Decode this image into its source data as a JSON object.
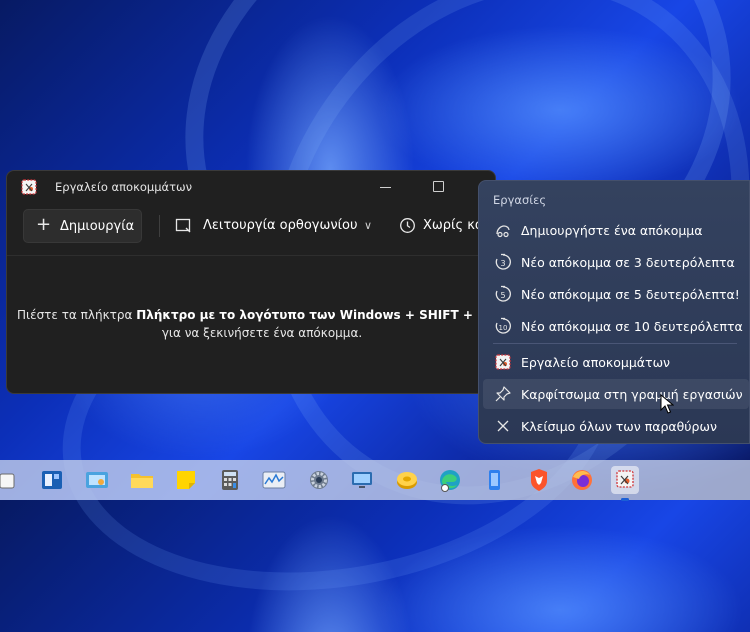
{
  "window": {
    "title": "Εργαλείο αποκομμάτων",
    "new_button": "Δημιουργία",
    "mode_label": "Λειτουργία ορθογωνίου",
    "delay_label": "Χωρίς κα",
    "message": {
      "pre": "Πιέστε τα πλήκτρα ",
      "bold": "Πλήκτρο με το λογότυπο των Windows + SHIFT +",
      "post_trunc": " ",
      "line2": "για να ξεκινήσετε ένα απόκομμα."
    }
  },
  "jumplist": {
    "header": "Εργασίες",
    "tasks": [
      {
        "label": "Δημιουργήστε ένα απόκομμα",
        "icon": "snip-icon"
      },
      {
        "label": "Νέο απόκομμα σε 3 δευτερόλεπτα",
        "icon": "timer-3-icon"
      },
      {
        "label": "Νέο απόκομμα σε 5 δευτερόλεπτα!",
        "icon": "timer-5-icon"
      },
      {
        "label": "Νέο απόκομμα σε 10 δευτερόλεπτα",
        "icon": "timer-10-icon"
      }
    ],
    "app": {
      "label": "Εργαλείο αποκομμάτων",
      "icon": "snipping-tool-icon"
    },
    "pin": {
      "label": "Καρφίτσωμα στη γραμμή εργασιών",
      "icon": "pin-icon"
    },
    "close_all": {
      "label": "Κλείσιμο όλων των παραθύρων",
      "icon": "close-icon"
    }
  },
  "taskbar": {
    "icons": [
      "task-view-icon",
      "widgets-icon",
      "control-panel-icon",
      "file-explorer-icon",
      "sticky-notes-icon",
      "calculator-icon",
      "resource-monitor-icon",
      "settings-icon",
      "remote-desktop-icon",
      "disk-icon",
      "edge-icon",
      "phone-link-icon",
      "brave-icon",
      "firefox-icon",
      "snipping-tool-icon"
    ]
  },
  "colors": {
    "accent": "#1b5fd6",
    "window_bg": "#202020",
    "jumplist_bg": "#2f3c5a"
  }
}
